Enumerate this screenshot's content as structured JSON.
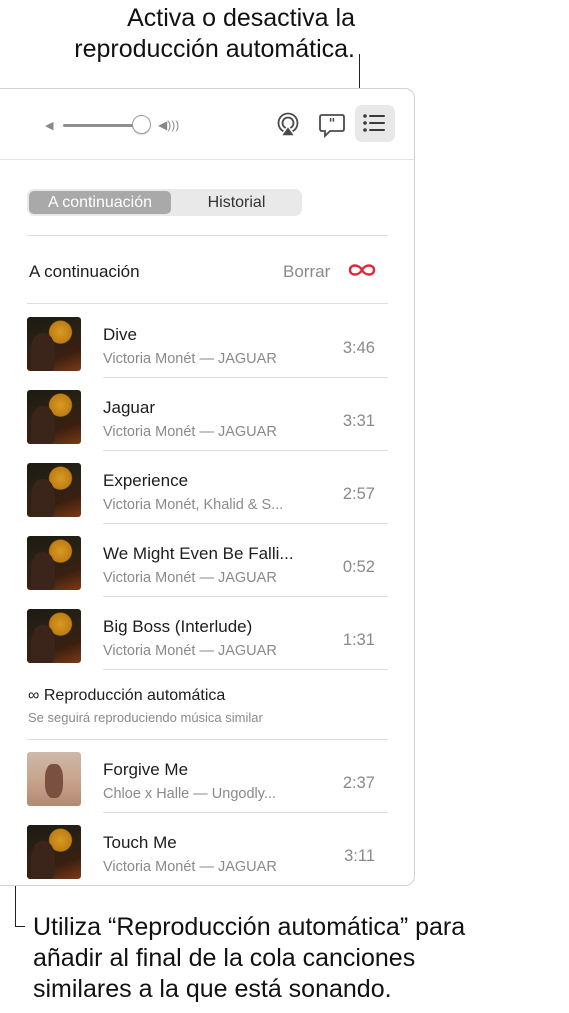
{
  "callouts": {
    "top_line1": "Activa o desactiva la",
    "top_line2": "reproducción automática.",
    "bottom_line1": "Utiliza “Reproducción automática” para",
    "bottom_line2": "añadir al final de la cola canciones",
    "bottom_line3": "similares a la que está sonando."
  },
  "toolbar": {
    "volume": 0.95,
    "icons": [
      "volume-low-icon",
      "volume-high-icon",
      "airplay-icon",
      "lyrics-icon",
      "queue-list-icon"
    ]
  },
  "tabs": [
    {
      "label": "A continuación",
      "selected": true
    },
    {
      "label": "Historial",
      "selected": false
    }
  ],
  "queue": {
    "title": "A continuación",
    "clear_label": "Borrar",
    "autoplay_icon": "infinity-icon",
    "accent_color": "#e0263a",
    "songs": [
      {
        "title": "Dive",
        "artist": "Victoria Monét — JAGUAR",
        "duration": "3:46"
      },
      {
        "title": "Jaguar",
        "artist": "Victoria Monét — JAGUAR",
        "duration": "3:31"
      },
      {
        "title": "Experience",
        "artist": "Victoria Monét, Khalid & S...",
        "duration": "2:57"
      },
      {
        "title": "We Might Even Be Falli...",
        "artist": "Victoria Monét — JAGUAR",
        "duration": "0:52"
      },
      {
        "title": "Big Boss (Interlude)",
        "artist": "Victoria Monét — JAGUAR",
        "duration": "1:31"
      }
    ]
  },
  "autoplay": {
    "title": "Reproducción automática",
    "subtitle": "Se seguirá reproduciendo música similar",
    "songs": [
      {
        "title": "Forgive Me",
        "artist": "Chloe x Halle — Ungodly...",
        "duration": "2:37"
      },
      {
        "title": "Touch Me",
        "artist": "Victoria Monét — JAGUAR",
        "duration": "3:11"
      }
    ]
  }
}
